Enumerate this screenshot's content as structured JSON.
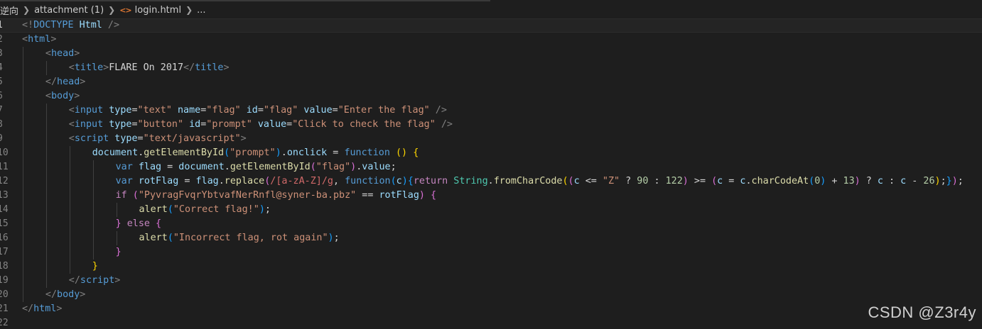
{
  "breadcrumb": {
    "items": [
      "逆向",
      "attachment (1)",
      "login.html",
      "..."
    ],
    "file_icon": "html-file-icon"
  },
  "editor": {
    "language": "html",
    "current_line": 1,
    "lines": [
      {
        "n": "1",
        "indent": 0,
        "tokens": [
          [
            "punc",
            "<!"
          ],
          [
            "tag",
            "DOCTYPE "
          ],
          [
            "attr",
            "Html"
          ],
          [
            "punc",
            " />"
          ]
        ]
      },
      {
        "n": "2",
        "indent": 0,
        "tokens": [
          [
            "punc",
            "<"
          ],
          [
            "tag",
            "html"
          ],
          [
            "punc",
            ">"
          ]
        ]
      },
      {
        "n": "3",
        "indent": 1,
        "tokens": [
          [
            "punc",
            "<"
          ],
          [
            "tag",
            "head"
          ],
          [
            "punc",
            ">"
          ]
        ]
      },
      {
        "n": "4",
        "indent": 2,
        "tokens": [
          [
            "punc",
            "<"
          ],
          [
            "tag",
            "title"
          ],
          [
            "punc",
            ">"
          ],
          [
            "text",
            "FLARE On 2017"
          ],
          [
            "punc",
            "</"
          ],
          [
            "tag",
            "title"
          ],
          [
            "punc",
            ">"
          ]
        ]
      },
      {
        "n": "5",
        "indent": 1,
        "tokens": [
          [
            "punc",
            "</"
          ],
          [
            "tag",
            "head"
          ],
          [
            "punc",
            ">"
          ]
        ]
      },
      {
        "n": "6",
        "indent": 1,
        "tokens": [
          [
            "punc",
            "<"
          ],
          [
            "tag",
            "body"
          ],
          [
            "punc",
            ">"
          ]
        ]
      },
      {
        "n": "7",
        "indent": 2,
        "tokens": [
          [
            "punc",
            "<"
          ],
          [
            "tag",
            "input "
          ],
          [
            "attr",
            "type"
          ],
          [
            "op",
            "="
          ],
          [
            "str",
            "\"text\""
          ],
          [
            "text",
            " "
          ],
          [
            "attr",
            "name"
          ],
          [
            "op",
            "="
          ],
          [
            "str",
            "\"flag\""
          ],
          [
            "text",
            " "
          ],
          [
            "attr",
            "id"
          ],
          [
            "op",
            "="
          ],
          [
            "str",
            "\"flag\""
          ],
          [
            "text",
            " "
          ],
          [
            "attr",
            "value"
          ],
          [
            "op",
            "="
          ],
          [
            "str",
            "\"Enter the flag\""
          ],
          [
            "punc",
            " />"
          ]
        ]
      },
      {
        "n": "8",
        "indent": 2,
        "tokens": [
          [
            "punc",
            "<"
          ],
          [
            "tag",
            "input "
          ],
          [
            "attr",
            "type"
          ],
          [
            "op",
            "="
          ],
          [
            "str",
            "\"button\""
          ],
          [
            "text",
            " "
          ],
          [
            "attr",
            "id"
          ],
          [
            "op",
            "="
          ],
          [
            "str",
            "\"prompt\""
          ],
          [
            "text",
            " "
          ],
          [
            "attr",
            "value"
          ],
          [
            "op",
            "="
          ],
          [
            "str",
            "\"Click to check the flag\""
          ],
          [
            "punc",
            " />"
          ]
        ]
      },
      {
        "n": "9",
        "indent": 2,
        "tokens": [
          [
            "punc",
            "<"
          ],
          [
            "tag",
            "script "
          ],
          [
            "attr",
            "type"
          ],
          [
            "op",
            "="
          ],
          [
            "str",
            "\"text/javascript\""
          ],
          [
            "punc",
            ">"
          ]
        ]
      },
      {
        "n": "10",
        "indent": 3,
        "tokens": [
          [
            "var",
            "document"
          ],
          [
            "op",
            "."
          ],
          [
            "fn",
            "getElementById"
          ],
          [
            "b3",
            "("
          ],
          [
            "str",
            "\"prompt\""
          ],
          [
            "b3",
            ")"
          ],
          [
            "op",
            "."
          ],
          [
            "var",
            "onclick"
          ],
          [
            "op",
            " = "
          ],
          [
            "kw",
            "function"
          ],
          [
            "op",
            " "
          ],
          [
            "b1",
            "()"
          ],
          [
            "op",
            " "
          ],
          [
            "b1",
            "{"
          ]
        ]
      },
      {
        "n": "11",
        "indent": 4,
        "tokens": [
          [
            "kw",
            "var "
          ],
          [
            "var",
            "flag"
          ],
          [
            "op",
            " = "
          ],
          [
            "var",
            "document"
          ],
          [
            "op",
            "."
          ],
          [
            "fn",
            "getElementById"
          ],
          [
            "b2",
            "("
          ],
          [
            "str",
            "\"flag\""
          ],
          [
            "b2",
            ")"
          ],
          [
            "op",
            "."
          ],
          [
            "var",
            "value"
          ],
          [
            "op",
            ";"
          ]
        ]
      },
      {
        "n": "12",
        "indent": 4,
        "tokens": [
          [
            "kw",
            "var "
          ],
          [
            "var",
            "rotFlag"
          ],
          [
            "op",
            " = "
          ],
          [
            "var",
            "flag"
          ],
          [
            "op",
            "."
          ],
          [
            "fn",
            "replace"
          ],
          [
            "b2",
            "("
          ],
          [
            "re",
            "/[a-zA-Z]/g"
          ],
          [
            "op",
            ", "
          ],
          [
            "kw",
            "function"
          ],
          [
            "b3",
            "("
          ],
          [
            "var",
            "c"
          ],
          [
            "b3",
            ")"
          ],
          [
            "b3",
            "{"
          ],
          [
            "ctrl",
            "return "
          ],
          [
            "cls",
            "String"
          ],
          [
            "op",
            "."
          ],
          [
            "fn",
            "fromCharCode"
          ],
          [
            "b1",
            "("
          ],
          [
            "b2",
            "("
          ],
          [
            "var",
            "c"
          ],
          [
            "op",
            " <= "
          ],
          [
            "str",
            "\"Z\""
          ],
          [
            "op",
            " ? "
          ],
          [
            "num",
            "90"
          ],
          [
            "op",
            " : "
          ],
          [
            "num",
            "122"
          ],
          [
            "b2",
            ")"
          ],
          [
            "op",
            " >= "
          ],
          [
            "b2",
            "("
          ],
          [
            "var",
            "c"
          ],
          [
            "op",
            " = "
          ],
          [
            "var",
            "c"
          ],
          [
            "op",
            "."
          ],
          [
            "fn",
            "charCodeAt"
          ],
          [
            "b3",
            "("
          ],
          [
            "num",
            "0"
          ],
          [
            "b3",
            ")"
          ],
          [
            "op",
            " + "
          ],
          [
            "num",
            "13"
          ],
          [
            "b2",
            ")"
          ],
          [
            "op",
            " ? "
          ],
          [
            "var",
            "c"
          ],
          [
            "op",
            " : "
          ],
          [
            "var",
            "c"
          ],
          [
            "op",
            " - "
          ],
          [
            "num",
            "26"
          ],
          [
            "b1",
            ")"
          ],
          [
            "op",
            ";"
          ],
          [
            "b3",
            "}"
          ],
          [
            "b2",
            ")"
          ],
          [
            "op",
            ";"
          ]
        ]
      },
      {
        "n": "13",
        "indent": 4,
        "tokens": [
          [
            "ctrl",
            "if "
          ],
          [
            "b2",
            "("
          ],
          [
            "str",
            "\"PyvragFvqrYbtvafNerRnfl@syner-ba.pbz\""
          ],
          [
            "op",
            " == "
          ],
          [
            "var",
            "rotFlag"
          ],
          [
            "b2",
            ")"
          ],
          [
            "op",
            " "
          ],
          [
            "b2",
            "{"
          ]
        ]
      },
      {
        "n": "14",
        "indent": 5,
        "tokens": [
          [
            "fn",
            "alert"
          ],
          [
            "b3",
            "("
          ],
          [
            "str",
            "\"Correct flag!\""
          ],
          [
            "b3",
            ")"
          ],
          [
            "op",
            ";"
          ]
        ]
      },
      {
        "n": "15",
        "indent": 4,
        "tokens": [
          [
            "b2",
            "}"
          ],
          [
            "ctrl",
            " else "
          ],
          [
            "b2",
            "{"
          ]
        ]
      },
      {
        "n": "16",
        "indent": 5,
        "tokens": [
          [
            "fn",
            "alert"
          ],
          [
            "b3",
            "("
          ],
          [
            "str",
            "\"Incorrect flag, rot again\""
          ],
          [
            "b3",
            ")"
          ],
          [
            "op",
            ";"
          ]
        ]
      },
      {
        "n": "17",
        "indent": 4,
        "tokens": [
          [
            "b2",
            "}"
          ]
        ]
      },
      {
        "n": "18",
        "indent": 3,
        "tokens": [
          [
            "b1",
            "}"
          ]
        ]
      },
      {
        "n": "19",
        "indent": 2,
        "tokens": [
          [
            "punc",
            "</"
          ],
          [
            "tag",
            "script"
          ],
          [
            "punc",
            ">"
          ]
        ]
      },
      {
        "n": "20",
        "indent": 1,
        "tokens": [
          [
            "punc",
            "</"
          ],
          [
            "tag",
            "body"
          ],
          [
            "punc",
            ">"
          ]
        ]
      },
      {
        "n": "21",
        "indent": 0,
        "tokens": [
          [
            "punc",
            "</"
          ],
          [
            "tag",
            "html"
          ],
          [
            "punc",
            ">"
          ]
        ]
      },
      {
        "n": "22",
        "indent": 0,
        "tokens": []
      }
    ]
  },
  "watermark": "CSDN @Z3r4y"
}
